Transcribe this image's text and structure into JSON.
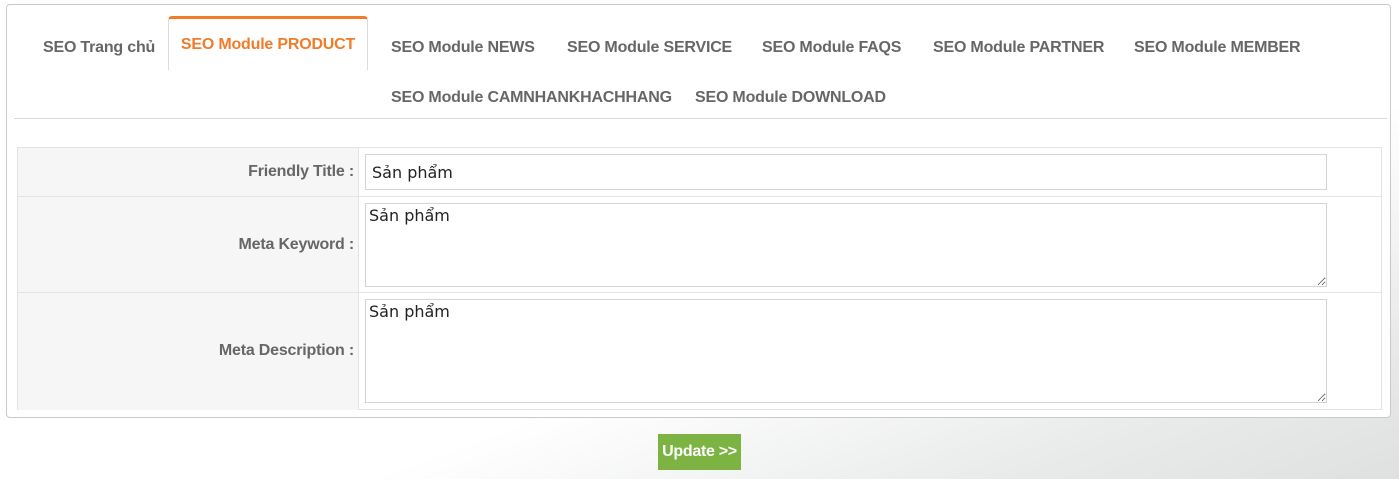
{
  "tabs": [
    {
      "label": "SEO Trang chủ",
      "active": false
    },
    {
      "label": "SEO Module PRODUCT",
      "active": true
    },
    {
      "label": "SEO Module NEWS",
      "active": false
    },
    {
      "label": "SEO Module SERVICE",
      "active": false
    },
    {
      "label": "SEO Module FAQS",
      "active": false
    },
    {
      "label": "SEO Module PARTNER",
      "active": false
    },
    {
      "label": "SEO Module MEMBER",
      "active": false
    },
    {
      "label": "SEO Module CAMNHANKHACHHANG",
      "active": false
    },
    {
      "label": "SEO Module DOWNLOAD",
      "active": false
    }
  ],
  "form": {
    "friendly_title": {
      "label": "Friendly Title :",
      "value": "Sản phẩm"
    },
    "meta_keyword": {
      "label": "Meta Keyword :",
      "value": "Sản phẩm"
    },
    "meta_description": {
      "label": "Meta Description :",
      "value": "Sản phẩm"
    }
  },
  "update_button": {
    "label": "Update >>"
  },
  "colors": {
    "active_tab": "#f07c2a",
    "tab_text": "#666666",
    "button_bg": "#7cb342",
    "button_text": "#ffffff"
  }
}
